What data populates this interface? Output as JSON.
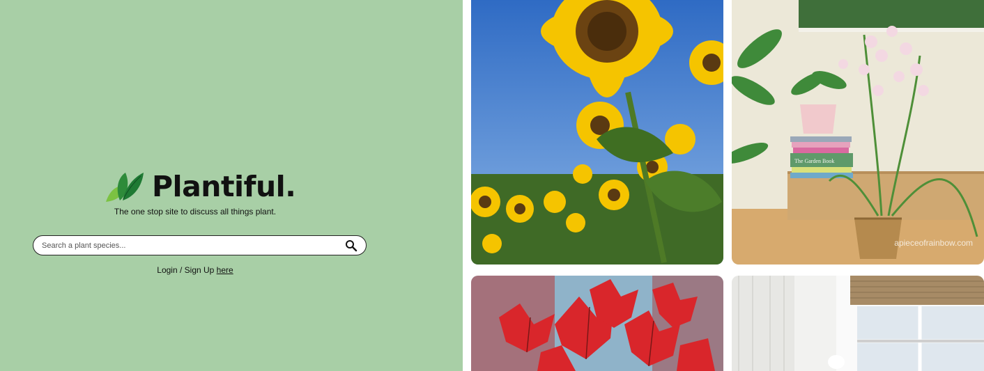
{
  "brand": {
    "name": "Plantiful.",
    "tagline": "The one stop site to discuss all things plant.",
    "logo_icon": "leaf-logo-icon",
    "accent": "#a8cfa6"
  },
  "search": {
    "placeholder": "Search a plant species...",
    "value": "",
    "icon": "search-icon"
  },
  "auth": {
    "prefix": "Login / Sign Up ",
    "link": "here"
  },
  "gallery": [
    {
      "subject": "sunflowers"
    },
    {
      "subject": "indoor orchid and houseplants",
      "watermark": "apieceofrainbow.com",
      "book_title": "The Garden Book"
    },
    {
      "subject": "red maple leaves"
    },
    {
      "subject": "white room with window blind"
    }
  ]
}
